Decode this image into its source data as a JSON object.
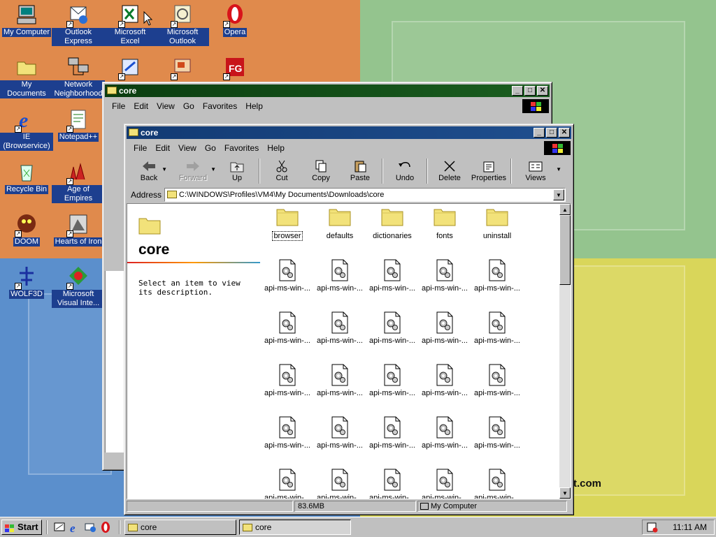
{
  "desktop": {
    "icons": [
      {
        "label": "My Computer"
      },
      {
        "label": "Outlook Express"
      },
      {
        "label": "Microsoft Excel"
      },
      {
        "label": "Microsoft Outlook"
      },
      {
        "label": "Opera"
      },
      {
        "label": "My Documents"
      },
      {
        "label": "Network Neighborhood"
      },
      {
        "label": "IE (Browservice)"
      },
      {
        "label": "Notepad++"
      },
      {
        "label": "Recycle Bin"
      },
      {
        "label": "Age of Empires"
      },
      {
        "label": "DOOM"
      },
      {
        "label": "Hearts of Iron"
      },
      {
        "label": "WOLF3D"
      },
      {
        "label": "Microsoft Visual Inte..."
      }
    ],
    "watermark_text": "t.com"
  },
  "back_window": {
    "title": "core",
    "menu": [
      "File",
      "Edit",
      "View",
      "Go",
      "Favorites",
      "Help"
    ]
  },
  "front_window": {
    "title": "core",
    "menu": [
      "File",
      "Edit",
      "View",
      "Go",
      "Favorites",
      "Help"
    ],
    "toolbar": {
      "back": "Back",
      "forward": "Forward",
      "up": "Up",
      "cut": "Cut",
      "copy": "Copy",
      "paste": "Paste",
      "undo": "Undo",
      "delete": "Delete",
      "properties": "Properties",
      "views": "Views"
    },
    "address_label": "Address",
    "address_value": "C:\\WINDOWS\\Profiles\\VM4\\My Documents\\Downloads\\core",
    "left_panel": {
      "folder_name": "core",
      "description": "Select an item to view its description."
    },
    "folders": [
      "browser",
      "defaults",
      "dictionaries",
      "fonts",
      "uninstall"
    ],
    "file_label": "api-ms-win-...",
    "status": {
      "size": "83.6MB",
      "zone": "My Computer"
    }
  },
  "taskbar": {
    "start": "Start",
    "tasks": [
      "core",
      "core"
    ],
    "clock": "11:11 AM"
  }
}
